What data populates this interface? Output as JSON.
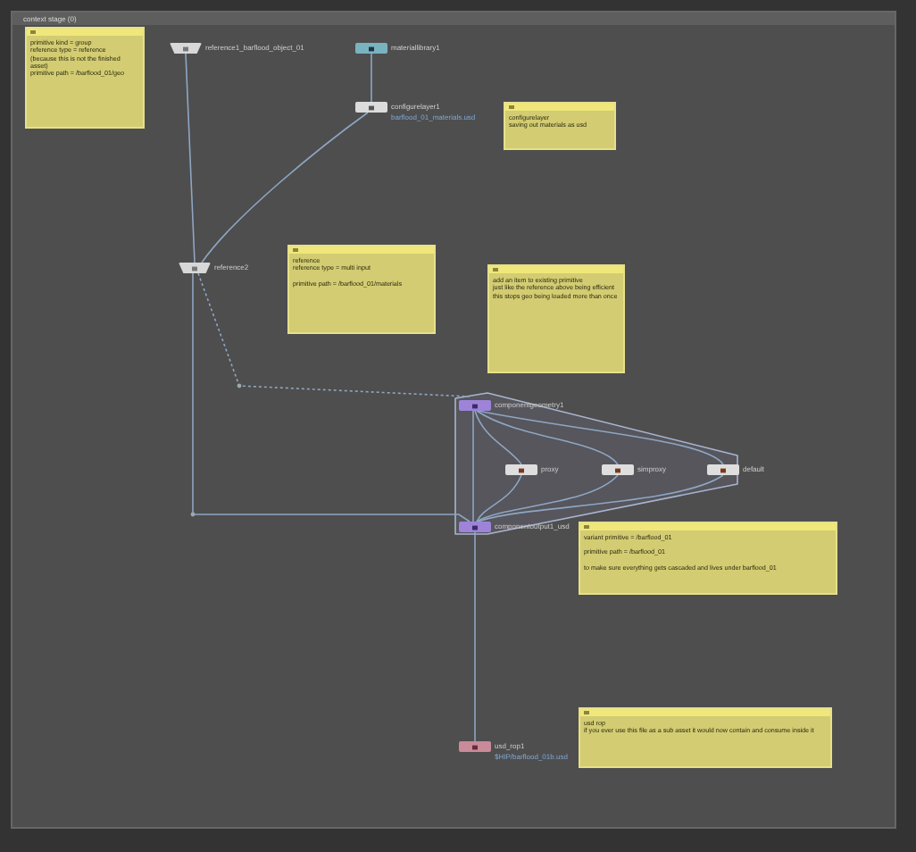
{
  "panel": {
    "title": "context stage (0)"
  },
  "nodes": [
    {
      "label": "reference1_barflood_object_01",
      "kind": "reference"
    },
    {
      "label": "materiallibrary1",
      "kind": "materiallibrary"
    },
    {
      "label": "configurelayer1",
      "kind": "configure",
      "subtitle": "barflood_01_materials.usd"
    },
    {
      "label": "reference2",
      "kind": "reference"
    },
    {
      "label": "componentgeometry1",
      "kind": "component"
    },
    {
      "label": "proxy",
      "kind": "geometry"
    },
    {
      "label": "simproxy",
      "kind": "geometry"
    },
    {
      "label": "default",
      "kind": "geometry"
    },
    {
      "label": "componentoutput1_usd",
      "kind": "component"
    },
    {
      "label": "usd_rop1",
      "kind": "rop",
      "subtitle": "$HIP/barflood_01b.usd"
    }
  ],
  "notes": [
    {
      "paragraphs": [
        "primitive kind = group\nreference type = reference\n(because this is not the finished asset)\nprimitive path = /barflood_01/geo"
      ]
    },
    {
      "paragraphs": [
        "configurelayer\nsaving out materials as usd"
      ]
    },
    {
      "paragraphs": [
        "reference\nreference type = multi input",
        "primitive path = /barflood_01/materials"
      ]
    },
    {
      "paragraphs": [
        "add an item to existing primitive\njust like the reference above being efficient\nthis stops geo being loaded more than once"
      ]
    },
    {
      "paragraphs": [
        "variant primitive = /barflood_01",
        "primitive path = /barflood_01",
        "to make sure everything gets cascaded and lives under barflood_01"
      ]
    },
    {
      "paragraphs": [
        "usd rop\nif you ever use this file as a sub asset it would now contain and consume inside it"
      ]
    }
  ]
}
